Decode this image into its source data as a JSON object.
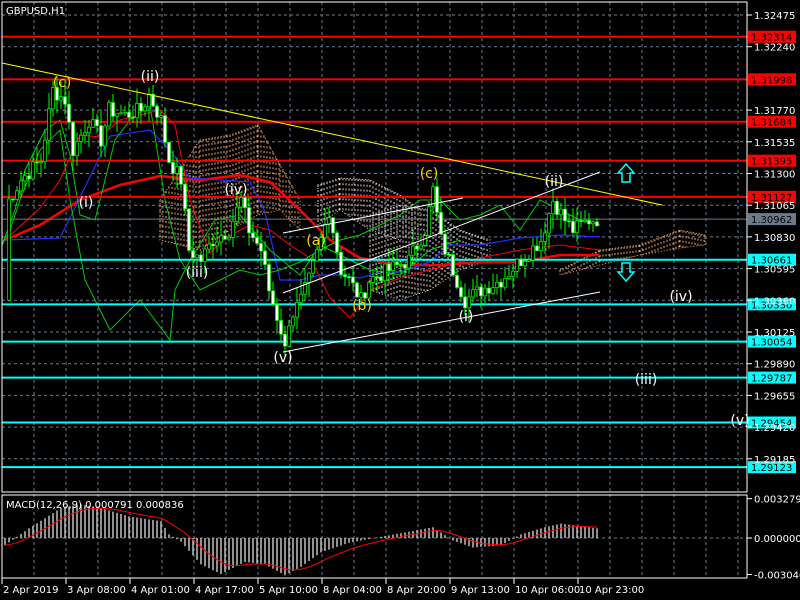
{
  "chart_data": {
    "type": "candlestick",
    "title": "GBPUSD,H1",
    "symbol": "GBPUSD",
    "timeframe": "H1",
    "ylim": [
      1.2905,
      1.3258
    ],
    "y_ticks": [
      "1.32475",
      "1.32240",
      "1.31770",
      "1.31535",
      "1.31300",
      "1.31065",
      "1.30830",
      "1.30595",
      "1.30360",
      "1.30125",
      "1.29890",
      "1.29655",
      "1.29420",
      "1.29185"
    ],
    "x_ticks": [
      "2 Apr 2019",
      "3 Apr 08:00",
      "4 Apr 01:00",
      "4 Apr 17:00",
      "5 Apr 10:00",
      "8 Apr 04:00",
      "8 Apr 20:00",
      "9 Apr 13:00",
      "10 Apr 06:00",
      "10 Apr 23:00"
    ],
    "current_price": {
      "value": 1.30962,
      "label": "1.30962",
      "color": "#6b7b8c"
    },
    "resistance_levels": [
      {
        "value": 1.32314,
        "label": "1.32314"
      },
      {
        "value": 1.31998,
        "label": "1.31998"
      },
      {
        "value": 1.31684,
        "label": "1.31684"
      },
      {
        "value": 1.31395,
        "label": "1.31395"
      },
      {
        "value": 1.31127,
        "label": "1.31127"
      }
    ],
    "support_levels": [
      {
        "value": 1.30661,
        "label": "1.30661"
      },
      {
        "value": 1.3033,
        "label": "1.30330"
      },
      {
        "value": 1.30054,
        "label": "1.30054"
      },
      {
        "value": 1.29787,
        "label": "1.29787"
      },
      {
        "value": 1.29454,
        "label": "1.29454"
      },
      {
        "value": 1.29123,
        "label": "1.29123"
      }
    ],
    "price_path": [
      [
        0,
        1.30362
      ],
      [
        1,
        1.31104
      ],
      [
        4,
        1.31252
      ],
      [
        9,
        1.314
      ],
      [
        12,
        1.31919
      ],
      [
        15,
        1.31845
      ],
      [
        17,
        1.31474
      ],
      [
        21,
        1.31697
      ],
      [
        24,
        1.31548
      ],
      [
        26,
        1.31771
      ],
      [
        30,
        1.31734
      ],
      [
        34,
        1.31771
      ],
      [
        36,
        1.31882
      ],
      [
        39,
        1.31697
      ],
      [
        41,
        1.314
      ],
      [
        44,
        1.31252
      ],
      [
        46,
        1.30733
      ],
      [
        49,
        1.30659
      ],
      [
        52,
        1.30807
      ],
      [
        56,
        1.30881
      ],
      [
        59,
        1.31104
      ],
      [
        61,
        1.30881
      ],
      [
        64,
        1.30733
      ],
      [
        66,
        1.30436
      ],
      [
        69,
        1.3014
      ],
      [
        70,
        1.29991
      ],
      [
        71,
        1.30214
      ],
      [
        74,
        1.30362
      ],
      [
        76,
        1.3051
      ],
      [
        79,
        1.30807
      ],
      [
        81,
        1.31029
      ],
      [
        84,
        1.30585
      ],
      [
        86,
        1.3051
      ],
      [
        89,
        1.30362
      ],
      [
        91,
        1.3051
      ],
      [
        96,
        1.30585
      ],
      [
        101,
        1.30659
      ],
      [
        105,
        1.30881
      ],
      [
        107,
        1.31178
      ],
      [
        109,
        1.30807
      ],
      [
        112,
        1.30585
      ],
      [
        115,
        1.30362
      ],
      [
        119,
        1.30436
      ],
      [
        124,
        1.3051
      ],
      [
        129,
        1.30659
      ],
      [
        134,
        1.30807
      ],
      [
        137,
        1.31104
      ],
      [
        140,
        1.30955
      ],
      [
        142,
        1.30881
      ],
      [
        146,
        1.30955
      ],
      [
        148,
        1.30962
      ]
    ],
    "wave_labels": [
      {
        "text": "(c)",
        "color": "#ffd400"
      },
      {
        "text": "(ii)",
        "color": "#ffffff"
      },
      {
        "text": "(i)",
        "color": "#ffffff"
      },
      {
        "text": "(iv)",
        "color": "#ffffff"
      },
      {
        "text": "(iii)",
        "color": "#ffffff"
      },
      {
        "text": "(v)",
        "color": "#ffffff"
      },
      {
        "text": "(a)",
        "color": "#ffd400"
      },
      {
        "text": "(b)",
        "color": "#ffd400"
      },
      {
        "text": "(c)",
        "color": "#ffd400"
      },
      {
        "text": "(ii)",
        "color": "#ffffff"
      },
      {
        "text": "(i)",
        "color": "#ffffff"
      },
      {
        "text": "(iv)",
        "color": "#ffffff"
      },
      {
        "text": "(iii)",
        "color": "#ffffff"
      },
      {
        "text": "(v)",
        "color": "#ffffff"
      }
    ],
    "macd": {
      "label": "MACD(12,26,9) 0.000791 0.000836",
      "ylim": [
        -0.00304,
        0.003279
      ],
      "y_ticks": [
        "0.003279",
        "0.000000",
        "-0.003040"
      ],
      "histogram": [
        [
          0,
          -0.0006
        ],
        [
          6,
          0.0008
        ],
        [
          14,
          0.0025
        ],
        [
          19,
          0.0028
        ],
        [
          24,
          0.0025
        ],
        [
          31,
          0.0018
        ],
        [
          39,
          0.0014
        ],
        [
          41,
          0.0003
        ],
        [
          44,
          -0.0003
        ],
        [
          49,
          -0.0022
        ],
        [
          54,
          -0.003
        ],
        [
          60,
          -0.002
        ],
        [
          65,
          -0.0022
        ],
        [
          70,
          -0.0031
        ],
        [
          74,
          -0.0024
        ],
        [
          79,
          -0.0012
        ],
        [
          86,
          -0.0004
        ],
        [
          94,
          0.0001
        ],
        [
          99,
          0.0004
        ],
        [
          107,
          0.0009
        ],
        [
          112,
          -0.0002
        ],
        [
          117,
          -0.0008
        ],
        [
          124,
          -0.0006
        ],
        [
          129,
          0.0003
        ],
        [
          135,
          0.0009
        ],
        [
          139,
          0.0012
        ],
        [
          148,
          0.0008
        ]
      ]
    },
    "colors": {
      "resistance": "#ff0000",
      "support": "#00ffff",
      "trendline": "#ffff00",
      "channel": "#ffffff",
      "bull": "#00ff00",
      "grid": "#6b7b8c"
    }
  }
}
